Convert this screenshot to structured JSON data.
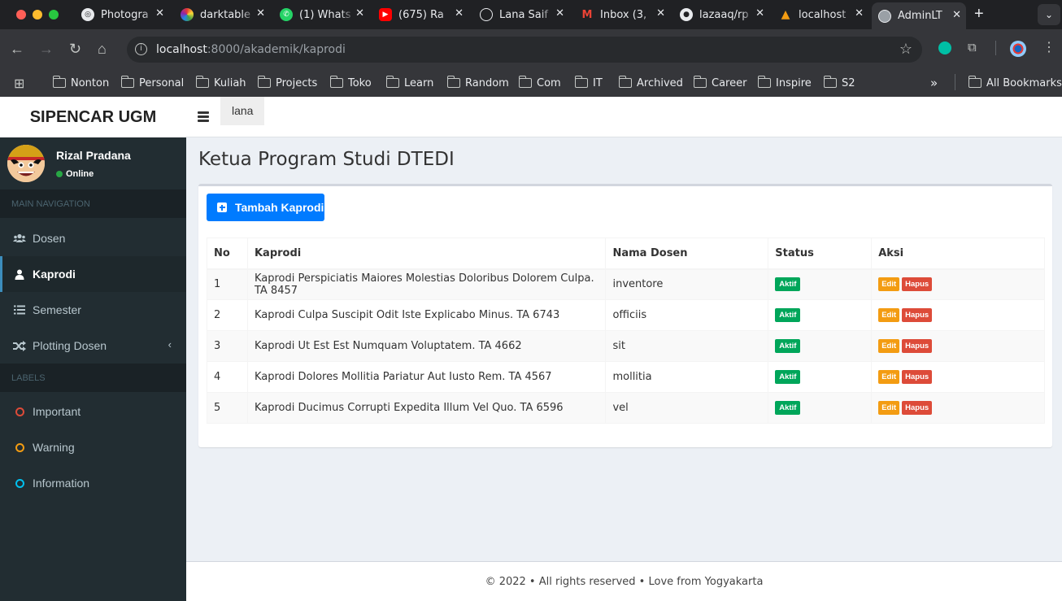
{
  "browser": {
    "tabs": [
      {
        "title": "Photogra",
        "icon": "photo-icon"
      },
      {
        "title": "darktable",
        "icon": "darktable-icon"
      },
      {
        "title": "(1) Whats",
        "icon": "whatsapp-icon"
      },
      {
        "title": "(675) Ra",
        "icon": "youtube-icon"
      },
      {
        "title": "Lana Saif",
        "icon": "globe-icon"
      },
      {
        "title": "Inbox (3,",
        "icon": "gmail-icon"
      },
      {
        "title": "lazaaq/rp",
        "icon": "github-icon"
      },
      {
        "title": "localhost",
        "icon": "localhost-icon"
      },
      {
        "title": "AdminLT",
        "icon": "globe-icon",
        "active": true
      }
    ],
    "url_host": "localhost",
    "url_path": ":8000/akademik/kaprodi",
    "bookmarks": [
      "Nonton",
      "Personal",
      "Kuliah",
      "Projects",
      "Toko",
      "Learn",
      "Random",
      "Com",
      "IT",
      "Archived",
      "Career",
      "Inspire",
      "S2"
    ],
    "all_bookmarks": "All Bookmarks",
    "more_bookmarks": "»"
  },
  "app": {
    "logo": "SIPENCAR UGM",
    "topnav_user": "lana",
    "user": {
      "name": "Rizal Pradana",
      "status": "Online"
    },
    "nav_header": "MAIN NAVIGATION",
    "nav": [
      {
        "label": "Dosen",
        "icon": "users-icon"
      },
      {
        "label": "Kaprodi",
        "icon": "user-icon",
        "active": true
      },
      {
        "label": "Semester",
        "icon": "list-icon"
      },
      {
        "label": "Plotting Dosen",
        "icon": "shuffle-icon",
        "chevron": "‹"
      }
    ],
    "labels_header": "LABELS",
    "labels": [
      {
        "label": "Important",
        "color": "#dd4b39"
      },
      {
        "label": "Warning",
        "color": "#f39c12"
      },
      {
        "label": "Information",
        "color": "#00c0ef"
      }
    ]
  },
  "main": {
    "title": "Ketua Program Studi DTEDI",
    "add_button": "Tambah Kaprodi",
    "table": {
      "headers": [
        "No",
        "Kaprodi",
        "Nama Dosen",
        "Status",
        "Aksi"
      ],
      "rows": [
        {
          "no": "1",
          "kaprodi": "Kaprodi Perspiciatis Maiores Molestias Doloribus Dolorem Culpa. TA 8457",
          "dosen": "inventore",
          "status": "Aktif"
        },
        {
          "no": "2",
          "kaprodi": "Kaprodi Culpa Suscipit Odit Iste Explicabo Minus. TA 6743",
          "dosen": "officiis",
          "status": "Aktif"
        },
        {
          "no": "3",
          "kaprodi": "Kaprodi Ut Est Est Numquam Voluptatem. TA 4662",
          "dosen": "sit",
          "status": "Aktif"
        },
        {
          "no": "4",
          "kaprodi": "Kaprodi Dolores Mollitia Pariatur Aut Iusto Rem. TA 4567",
          "dosen": "mollitia",
          "status": "Aktif"
        },
        {
          "no": "5",
          "kaprodi": "Kaprodi Ducimus Corrupti Expedita Illum Vel Quo. TA 6596",
          "dosen": "vel",
          "status": "Aktif"
        }
      ],
      "edit_label": "Edit",
      "delete_label": "Hapus"
    },
    "footer": "© 2022 • All rights reserved • Love from Yogyakarta"
  }
}
